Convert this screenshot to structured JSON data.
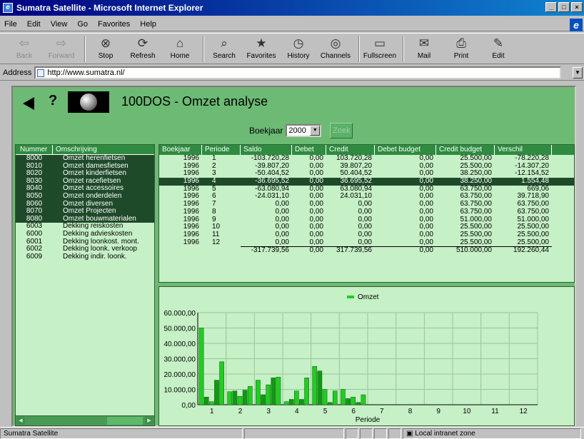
{
  "window": {
    "title": "Sumatra Satellite - Microsoft Internet Explorer"
  },
  "menu": [
    "File",
    "Edit",
    "View",
    "Go",
    "Favorites",
    "Help"
  ],
  "toolbar": [
    {
      "label": "Back",
      "icon": "back-arrow-icon",
      "glyph": "⇦",
      "disabled": true
    },
    {
      "label": "Forward",
      "icon": "forward-arrow-icon",
      "glyph": "⇨",
      "disabled": true
    },
    {
      "label": "Stop",
      "icon": "stop-icon",
      "glyph": "⊗",
      "disabled": false
    },
    {
      "label": "Refresh",
      "icon": "refresh-icon",
      "glyph": "⟳",
      "disabled": false
    },
    {
      "label": "Home",
      "icon": "home-icon",
      "glyph": "⌂",
      "disabled": false
    },
    {
      "label": "Search",
      "icon": "search-icon",
      "glyph": "⌕",
      "disabled": false
    },
    {
      "label": "Favorites",
      "icon": "favorites-icon",
      "glyph": "★",
      "disabled": false
    },
    {
      "label": "History",
      "icon": "history-icon",
      "glyph": "◷",
      "disabled": false
    },
    {
      "label": "Channels",
      "icon": "channels-icon",
      "glyph": "◎",
      "disabled": false
    },
    {
      "label": "Fullscreen",
      "icon": "fullscreen-icon",
      "glyph": "▭",
      "disabled": false
    },
    {
      "label": "Mail",
      "icon": "mail-icon",
      "glyph": "✉",
      "disabled": false
    },
    {
      "label": "Print",
      "icon": "print-icon",
      "glyph": "⎙",
      "disabled": false
    },
    {
      "label": "Edit",
      "icon": "edit-icon",
      "glyph": "✎",
      "disabled": false
    }
  ],
  "address": {
    "label": "Address",
    "url": "http://www.sumatra.nl/"
  },
  "app": {
    "help_glyph": "?",
    "title": "100DOS - Omzet analyse",
    "boekjaar_label": "Boekjaar",
    "boekjaar_value": "2000",
    "zoek_label": "Zoek"
  },
  "accounts": {
    "headers": [
      "Nummer",
      "Omschrijving"
    ],
    "rows": [
      {
        "nummer": "8000",
        "omschrijving": "Omzet herenfietsen",
        "selected": true
      },
      {
        "nummer": "8010",
        "omschrijving": "Omzet damesfietsen",
        "selected": true
      },
      {
        "nummer": "8020",
        "omschrijving": "Omzet kinderfietsen",
        "selected": true
      },
      {
        "nummer": "8030",
        "omschrijving": "Omzet racefietsen",
        "selected": true
      },
      {
        "nummer": "8040",
        "omschrijving": "Omzet accessoires",
        "selected": true
      },
      {
        "nummer": "8050",
        "omschrijving": "Omzet onderdelen",
        "selected": true
      },
      {
        "nummer": "8060",
        "omschrijving": "Omzet diversen",
        "selected": true
      },
      {
        "nummer": "8070",
        "omschrijving": "Omzet Projecten",
        "selected": true
      },
      {
        "nummer": "8080",
        "omschrijving": "Omzet bouwmaterialen",
        "selected": true
      },
      {
        "nummer": "6003",
        "omschrijving": "Dekking reiskosten",
        "selected": false
      },
      {
        "nummer": "6000",
        "omschrijving": "Dekking advieskosten",
        "selected": false
      },
      {
        "nummer": "6001",
        "omschrijving": "Dekking loonkost. mont.",
        "selected": false
      },
      {
        "nummer": "6002",
        "omschrijving": "Dekking loonk. verkoop",
        "selected": false
      },
      {
        "nummer": "6009",
        "omschrijving": "Dekking indir. loonk.",
        "selected": false
      }
    ]
  },
  "table": {
    "headers": [
      "Boekjaar",
      "Periode",
      "Saldo",
      "Debet",
      "Credit",
      "Debet budget",
      "Credit budget",
      "Verschil"
    ],
    "rows": [
      [
        "1996",
        "1",
        "-103.720,28",
        "0,00",
        "103.720,28",
        "0,00",
        "25.500,00",
        "-78.220,28"
      ],
      [
        "1996",
        "2",
        "-39.807,20",
        "0,00",
        "39.807,20",
        "0,00",
        "25.500,00",
        "-14.307,20"
      ],
      [
        "1996",
        "3",
        "-50.404,52",
        "0,00",
        "50.404,52",
        "0,00",
        "38.250,00",
        "-12.154,52"
      ],
      [
        "1996",
        "4",
        "-36.695,52",
        "0,00",
        "36.695,52",
        "0,00",
        "38.250,00",
        "1.554,48"
      ],
      [
        "1996",
        "5",
        "-63.080,94",
        "0,00",
        "63.080,94",
        "0,00",
        "63.750,00",
        "669,06"
      ],
      [
        "1996",
        "6",
        "-24.031,10",
        "0,00",
        "24.031,10",
        "0,00",
        "63.750,00",
        "39.718,90"
      ],
      [
        "1996",
        "7",
        "0,00",
        "0,00",
        "0,00",
        "0,00",
        "63.750,00",
        "63.750,00"
      ],
      [
        "1996",
        "8",
        "0,00",
        "0,00",
        "0,00",
        "0,00",
        "63.750,00",
        "63.750,00"
      ],
      [
        "1996",
        "9",
        "0,00",
        "0,00",
        "0,00",
        "0,00",
        "51.000,00",
        "51.000,00"
      ],
      [
        "1996",
        "10",
        "0,00",
        "0,00",
        "0,00",
        "0,00",
        "25.500,00",
        "25.500,00"
      ],
      [
        "1996",
        "11",
        "0,00",
        "0,00",
        "0,00",
        "0,00",
        "25.500,00",
        "25.500,00"
      ],
      [
        "1996",
        "12",
        "0,00",
        "0,00",
        "0,00",
        "0,00",
        "25.500,00",
        "25.500,00"
      ]
    ],
    "selected_row": 3,
    "totals": [
      "",
      "",
      "-317.739,56",
      "0,00",
      "317.739,56",
      "0,00",
      "510.000,00",
      "192.260,44"
    ]
  },
  "chart_data": {
    "type": "bar",
    "title": "",
    "legend": [
      "Omzet"
    ],
    "legend_position": "top-center",
    "xlabel": "Periode",
    "ylabel": "",
    "categories": [
      "1",
      "2",
      "3",
      "4",
      "5",
      "6",
      "7",
      "8",
      "9",
      "10",
      "11",
      "12"
    ],
    "ylim": [
      0,
      60000
    ],
    "yticks": [
      "0,00",
      "10.000,00",
      "20.000,00",
      "30.000,00",
      "40.000,00",
      "50.000,00",
      "60.000,00"
    ],
    "grid": true,
    "bars_per_period": [
      [
        50000,
        5000,
        2000,
        16000,
        28000
      ],
      [
        8500,
        9000,
        5500,
        9500,
        12000
      ],
      [
        16000,
        6500,
        13000,
        17500,
        18000
      ],
      [
        2000,
        3500,
        9000,
        3500,
        17500
      ],
      [
        25000,
        22000,
        10000,
        1500,
        9000
      ],
      [
        10000,
        4000,
        5000,
        1500,
        6500
      ],
      [
        0,
        0,
        0,
        0,
        0
      ],
      [
        0,
        0,
        0,
        0,
        0
      ],
      [
        0,
        0,
        0,
        0,
        0
      ],
      [
        0,
        0,
        0,
        0,
        0
      ],
      [
        0,
        0,
        0,
        0,
        0
      ],
      [
        0,
        0,
        0,
        0,
        0
      ]
    ],
    "colors": [
      "#22cc22",
      "#119911"
    ]
  },
  "status": {
    "text": "Sumatra Satellite",
    "zone": "Local intranet zone"
  }
}
